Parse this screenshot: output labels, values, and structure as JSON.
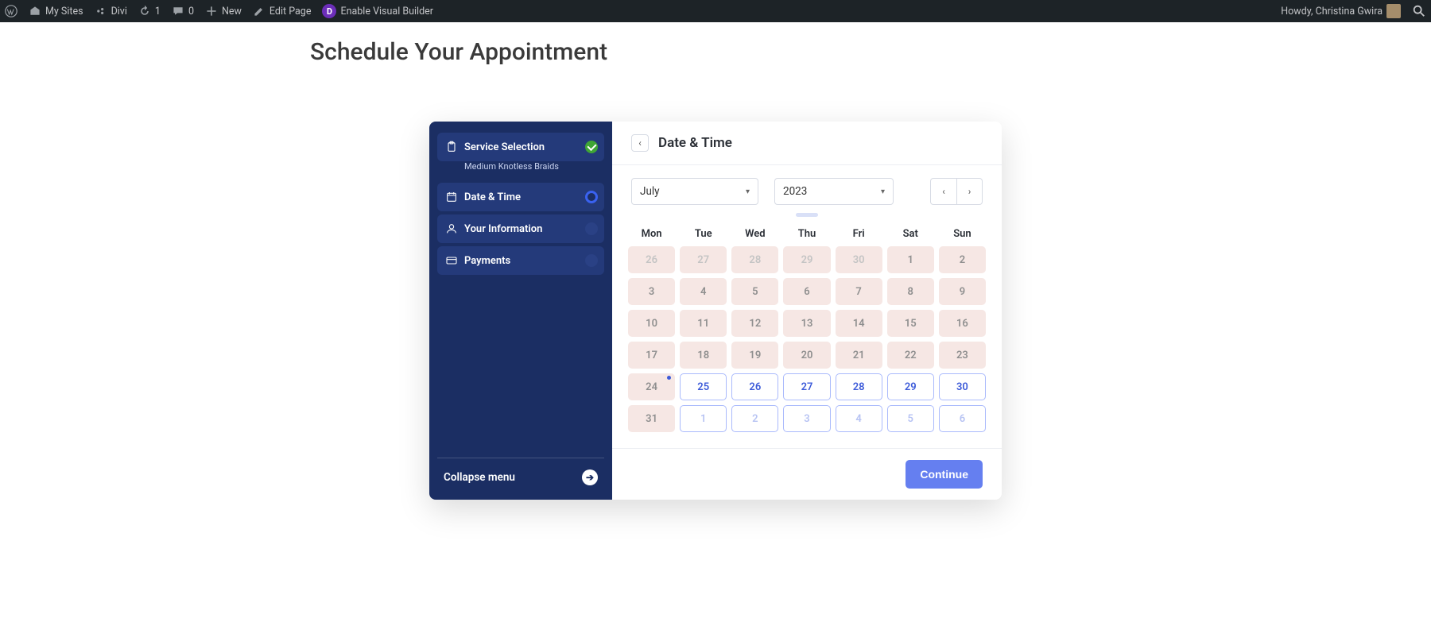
{
  "adminbar": {
    "my_sites": "My Sites",
    "site_name": "Divi",
    "updates": "1",
    "comments": "0",
    "new": "New",
    "edit_page": "Edit Page",
    "enable_vb": "Enable Visual Builder",
    "howdy": "Howdy, Christina Gwira"
  },
  "page": {
    "heading": "Schedule Your Appointment"
  },
  "sidebar": {
    "steps": {
      "service": "Service Selection",
      "service_sub": "Medium Knotless Braids",
      "datetime": "Date & Time",
      "info": "Your Information",
      "payments": "Payments"
    },
    "collapse": "Collapse menu"
  },
  "panel": {
    "title": "Date & Time",
    "month": "July",
    "year": "2023",
    "dow": [
      "Mon",
      "Tue",
      "Wed",
      "Thu",
      "Fri",
      "Sat",
      "Sun"
    ],
    "continue": "Continue",
    "weeks": [
      [
        {
          "n": "26",
          "cls": "past muted"
        },
        {
          "n": "27",
          "cls": "past muted"
        },
        {
          "n": "28",
          "cls": "past muted"
        },
        {
          "n": "29",
          "cls": "past muted"
        },
        {
          "n": "30",
          "cls": "past muted"
        },
        {
          "n": "1",
          "cls": "past"
        },
        {
          "n": "2",
          "cls": "past"
        }
      ],
      [
        {
          "n": "3",
          "cls": "past"
        },
        {
          "n": "4",
          "cls": "past"
        },
        {
          "n": "5",
          "cls": "past"
        },
        {
          "n": "6",
          "cls": "past"
        },
        {
          "n": "7",
          "cls": "past"
        },
        {
          "n": "8",
          "cls": "past"
        },
        {
          "n": "9",
          "cls": "past"
        }
      ],
      [
        {
          "n": "10",
          "cls": "past"
        },
        {
          "n": "11",
          "cls": "past"
        },
        {
          "n": "12",
          "cls": "past"
        },
        {
          "n": "13",
          "cls": "past"
        },
        {
          "n": "14",
          "cls": "past"
        },
        {
          "n": "15",
          "cls": "past"
        },
        {
          "n": "16",
          "cls": "past"
        }
      ],
      [
        {
          "n": "17",
          "cls": "past"
        },
        {
          "n": "18",
          "cls": "past"
        },
        {
          "n": "19",
          "cls": "past"
        },
        {
          "n": "20",
          "cls": "past"
        },
        {
          "n": "21",
          "cls": "past"
        },
        {
          "n": "22",
          "cls": "past"
        },
        {
          "n": "23",
          "cls": "past"
        }
      ],
      [
        {
          "n": "24",
          "cls": "past",
          "dot": true
        },
        {
          "n": "25",
          "cls": "avail"
        },
        {
          "n": "26",
          "cls": "avail"
        },
        {
          "n": "27",
          "cls": "avail"
        },
        {
          "n": "28",
          "cls": "avail"
        },
        {
          "n": "29",
          "cls": "avail"
        },
        {
          "n": "30",
          "cls": "avail"
        }
      ],
      [
        {
          "n": "31",
          "cls": "past"
        },
        {
          "n": "1",
          "cls": "avail dim"
        },
        {
          "n": "2",
          "cls": "avail dim"
        },
        {
          "n": "3",
          "cls": "avail dim"
        },
        {
          "n": "4",
          "cls": "avail dim"
        },
        {
          "n": "5",
          "cls": "avail dim"
        },
        {
          "n": "6",
          "cls": "avail dim"
        }
      ]
    ]
  }
}
